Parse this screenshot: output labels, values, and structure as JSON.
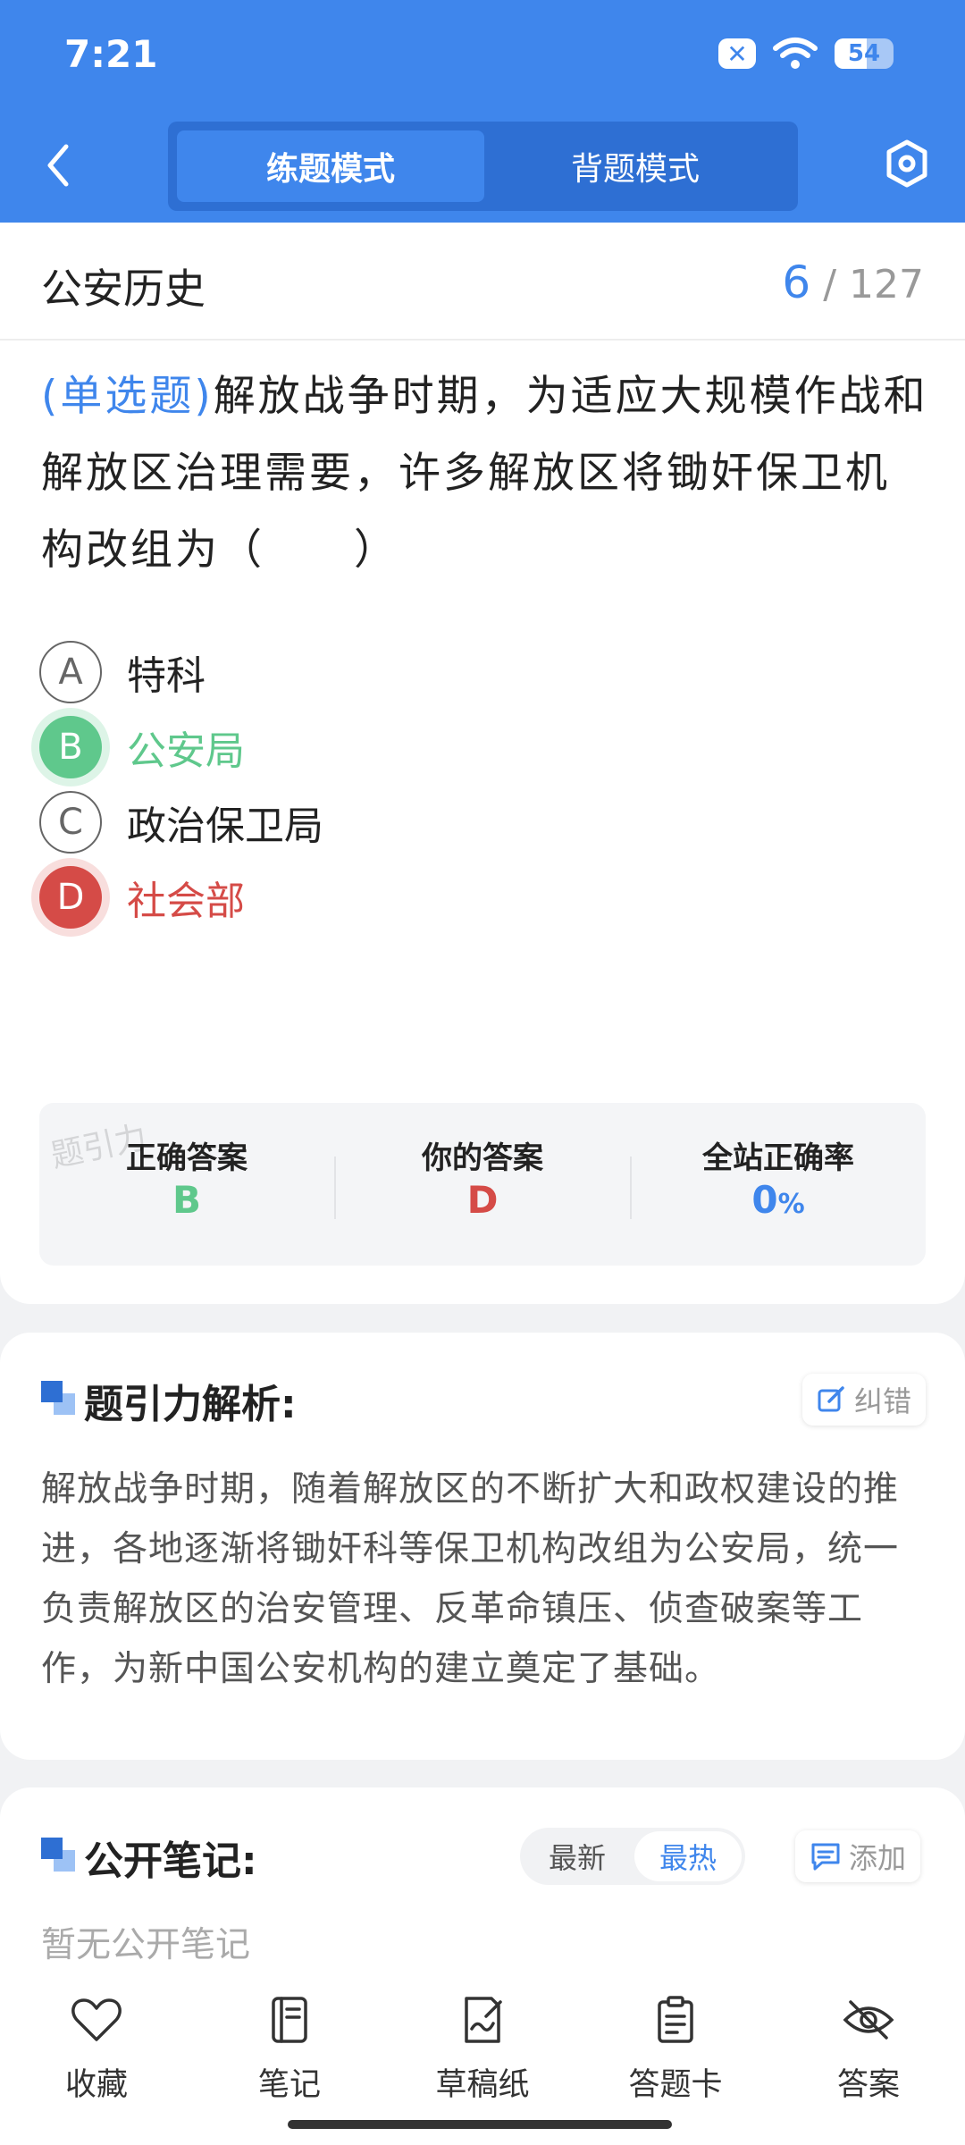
{
  "status_bar": {
    "time": "7:21",
    "battery": "54",
    "battery_level": 0.54
  },
  "header": {
    "tabs": [
      {
        "label": "练题模式",
        "active": true
      },
      {
        "label": "背题模式",
        "active": false
      }
    ]
  },
  "question": {
    "subject": "公安历史",
    "current_index": "6",
    "separator": "/",
    "total": "127",
    "type_label": "(单选题)",
    "text": "解放战争时期，为适应大规模作战和解放区治理需要，许多解放区将锄奸保卫机构改组为（　　）",
    "options": [
      {
        "letter": "A",
        "text": "特科",
        "state": "normal"
      },
      {
        "letter": "B",
        "text": "公安局",
        "state": "correct"
      },
      {
        "letter": "C",
        "text": "政治保卫局",
        "state": "normal"
      },
      {
        "letter": "D",
        "text": "社会部",
        "state": "wrong"
      }
    ]
  },
  "answer_summary": {
    "correct_label": "正确答案",
    "correct_value": "B",
    "yours_label": "你的答案",
    "yours_value": "D",
    "rate_label": "全站正确率",
    "rate_value": "0",
    "rate_unit": "%",
    "watermark": "题引力"
  },
  "analysis": {
    "title": "题引力解析:",
    "report_label": "纠错",
    "text": "解放战争时期，随着解放区的不断扩大和政权建设的推进，各地逐渐将锄奸科等保卫机构改组为公安局，统一负责解放区的治安管理、反革命镇压、侦查破案等工作，为新中国公安机构的建立奠定了基础。"
  },
  "notes": {
    "title": "公开笔记:",
    "sort_newest": "最新",
    "sort_hottest": "最热",
    "add_label": "添加",
    "empty_text": "暂无公开笔记"
  },
  "bottom_bar": {
    "items": [
      {
        "label": "收藏",
        "icon": "heart-icon"
      },
      {
        "label": "笔记",
        "icon": "notebook-icon"
      },
      {
        "label": "草稿纸",
        "icon": "draft-icon"
      },
      {
        "label": "答题卡",
        "icon": "clipboard-icon"
      },
      {
        "label": "答案",
        "icon": "eye-off-icon"
      }
    ]
  },
  "colors": {
    "primary": "#3F86EC",
    "correct": "#5FC88C",
    "wrong": "#D54B47"
  }
}
